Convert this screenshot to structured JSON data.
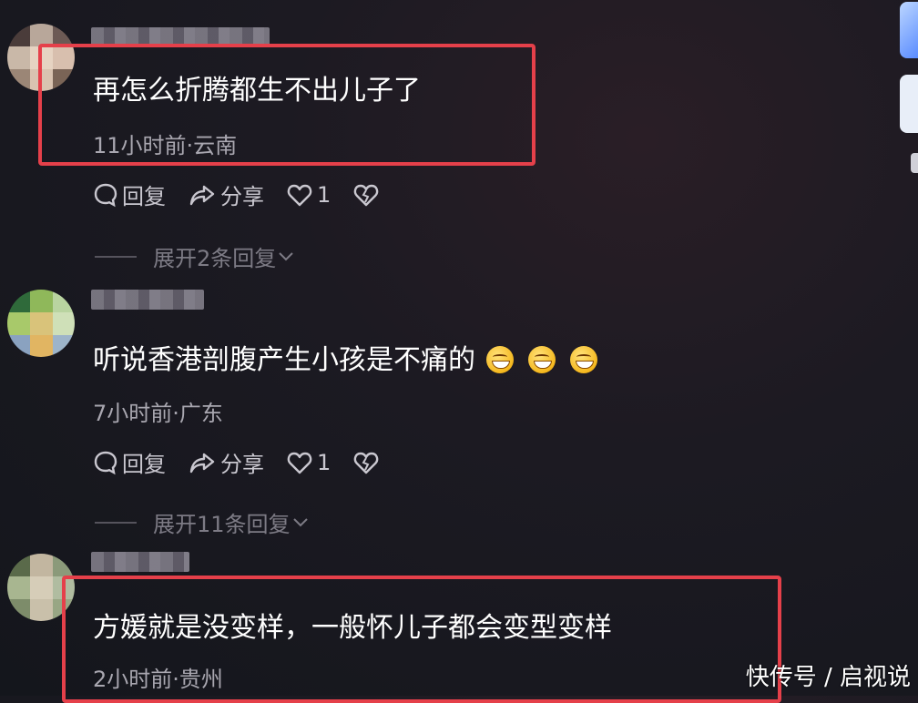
{
  "comments": [
    {
      "text": "再怎么折腾都生不出儿子了",
      "meta": "11小时前·云南",
      "reply_label": "回复",
      "share_label": "分享",
      "like_count": "1",
      "expand_label": "展开2条回复",
      "highlighted": true
    },
    {
      "text": "听说香港剖腹产生小孩是不痛的",
      "emoji_count": 3,
      "emoji": "grinning-face-emoji",
      "meta": "7小时前·广东",
      "reply_label": "回复",
      "share_label": "分享",
      "like_count": "1",
      "expand_label": "展开11条回复",
      "highlighted": false
    },
    {
      "text": "方媛就是没变样，一般怀儿子都会变型变样",
      "meta": "2小时前·贵州",
      "highlighted": true
    }
  ],
  "watermark": "快传号 / 启视说",
  "colors": {
    "highlight_border": "#e5404a",
    "meta_text": "#a9a7b0",
    "background": "#1c1a22"
  }
}
